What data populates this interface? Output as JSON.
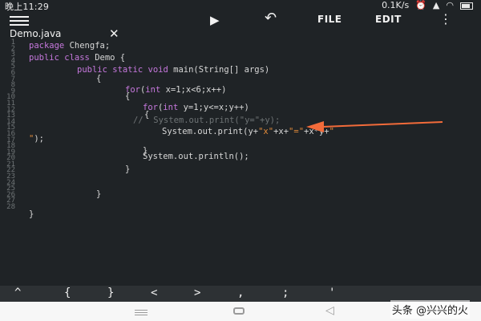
{
  "status_bar": {
    "time": "晚上11:29",
    "network_speed": "0.1K/s"
  },
  "toolbar": {
    "file_label": "FILE",
    "edit_label": "EDIT"
  },
  "tab": {
    "title": "Demo.java"
  },
  "gutter": {
    "line_numbers": [
      "1",
      "2",
      "3",
      "4",
      "5",
      "6",
      "7",
      "8",
      "9",
      "10",
      "11",
      "12",
      "13",
      "14",
      "15",
      "16",
      "17",
      "18",
      "19",
      "20",
      "21",
      "22",
      "23",
      "24",
      "25",
      "26",
      "27",
      "28"
    ]
  },
  "code": {
    "line1_kw": "package",
    "line1_rest": " Chengfa;",
    "line2_kw1": "public",
    "line2_kw2": "class",
    "line2_rest": " Demo {",
    "line3_kw1": "public",
    "line3_kw2": "static",
    "line3_kw3": "void",
    "line3_rest": " main(String[] args)",
    "line4": "{",
    "line5_kw": "for",
    "line5_p1": "(",
    "line5_ty": "int",
    "line5_rest": " x=1;x<6;x++)",
    "line6": "{",
    "line7_kw": "for",
    "line7_p1": "(",
    "line7_ty": "int",
    "line7_rest": " y=1;y<=x;y++)",
    "line8": "{",
    "line9_comment": "//  System.out.print(\"y=\"+y);",
    "line10_a": "System.out.print(y+",
    "line10_s1": "\"x\"",
    "line10_b": "+x+",
    "line10_s2": "\"=\"",
    "line10_c": "+x*y+",
    "line10_s3": "\"",
    "line11_s": "\"",
    "line11_rest": ");",
    "line12": "}",
    "line13": "System.out.println();",
    "line14": "}",
    "line15": "}",
    "line16": "}"
  },
  "keybar": {
    "keys": [
      "^",
      "{",
      "}",
      "<",
      ">",
      ",",
      ";",
      "'"
    ]
  },
  "watermark": "头条 @兴兴的火",
  "colors": {
    "background": "#1f2326",
    "keyword": "#c678dd",
    "string": "#e08a3a",
    "arrow": "#f26b3a"
  },
  "icons": {
    "menu": "hamburger-icon",
    "run": "play-icon",
    "undo": "undo-icon",
    "more": "more-icon",
    "close_tab": "close-icon"
  }
}
